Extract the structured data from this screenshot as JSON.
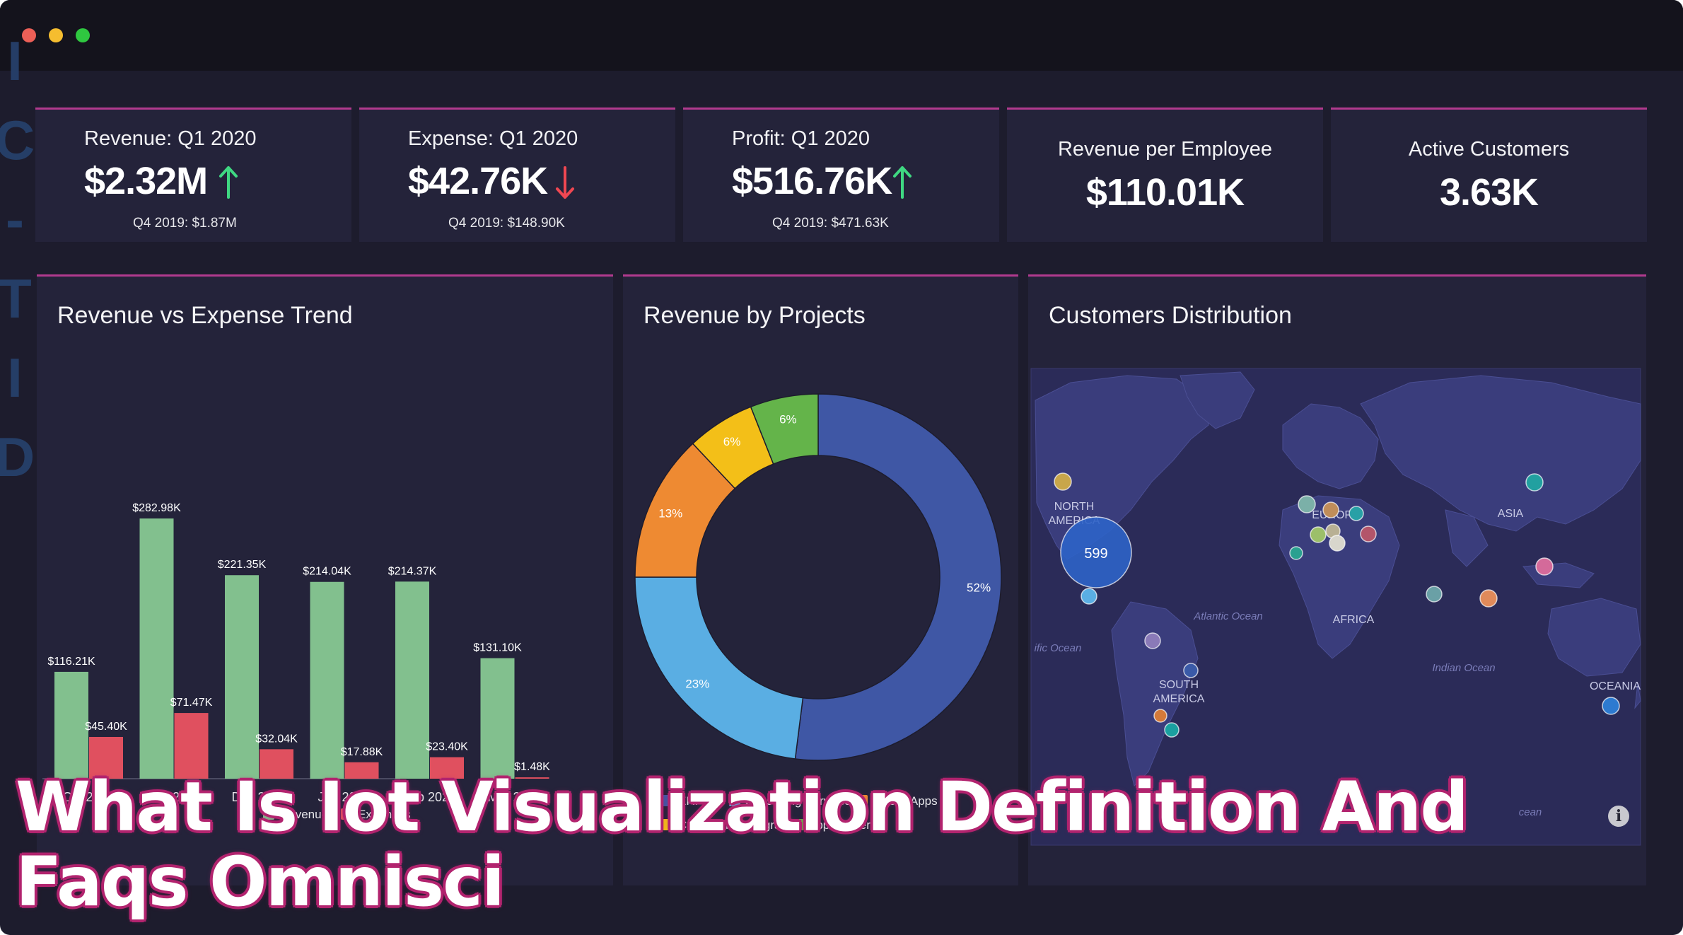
{
  "window": {
    "traffic_lights": [
      "#ec5f57",
      "#f5bd2f",
      "#2fc840"
    ],
    "side_letters": "IC-TID"
  },
  "kpis": [
    {
      "title": "Revenue: Q1 2020",
      "value": "$2.32M",
      "trend": "up",
      "previous": "Q4 2019: $1.87M"
    },
    {
      "title": "Expense: Q1 2020",
      "value": "$42.76K",
      "trend": "down",
      "previous": "Q4 2019: $148.90K"
    },
    {
      "title": "Profit: Q1 2020",
      "value": "$516.76K",
      "trend": "up",
      "previous": "Q4 2019: $471.63K"
    },
    {
      "title": "Revenue per Employee",
      "value": "$110.01K"
    },
    {
      "title": "Active Customers",
      "value": "3.63K"
    }
  ],
  "colors": {
    "up": "#3fd882",
    "down": "#f04752",
    "accent": "#b13a8e",
    "revenue": "#82c08e",
    "expense": "#e0505f"
  },
  "panels": {
    "trend_title": "Revenue vs Expense Trend",
    "projects_title": "Revenue by Projects",
    "customers_title": "Customers Distribution"
  },
  "trend_legend": [
    "Revenue",
    "Expenses"
  ],
  "chart_data": [
    {
      "type": "bar",
      "title": "Revenue vs Expense Trend",
      "categories": [
        "Oct 2019",
        "Nov 2019",
        "Dec 2019",
        "Jan 2020",
        "Feb 2020",
        "Mar 2020"
      ],
      "series": [
        {
          "name": "Revenue",
          "values": [
            116.21,
            282.98,
            221.35,
            214.04,
            214.37,
            131.1
          ],
          "labels": [
            "$116.21K",
            "$282.98K",
            "$221.35K",
            "$214.04K",
            "$214.37K",
            "$131.10K"
          ],
          "color": "#82c08e"
        },
        {
          "name": "Expenses",
          "values": [
            45.4,
            71.47,
            32.04,
            17.88,
            23.4,
            1.48
          ],
          "labels": [
            "$45.40K",
            "$71.47K",
            "$32.04K",
            "$17.88K",
            "$23.40K",
            "$1.48K"
          ],
          "color": "#e0505f"
        }
      ],
      "ylim": [
        0,
        300
      ],
      "legend": "bottom-left"
    },
    {
      "type": "pie",
      "title": "Revenue by Projects",
      "donut": true,
      "slices": [
        {
          "label": "ERP",
          "value": 52,
          "text": "52%",
          "color": "#3f57a5"
        },
        {
          "label": "Consulting Services",
          "value": 23,
          "text": "23%",
          "color": "#5aaee3"
        },
        {
          "label": "Mobile Apps",
          "value": 13,
          "text": "13%",
          "color": "#ee8a32"
        },
        {
          "label": "Certification Programs",
          "value": 6,
          "text": "6%",
          "color": "#f3bf18"
        },
        {
          "label": "App Builder",
          "value": 6,
          "text": "6%",
          "color": "#64b44a"
        }
      ],
      "legend": "bottom"
    }
  ],
  "map": {
    "labels": [
      {
        "text": "NORTH AMERICA",
        "lines": [
          "NORTH",
          "AMERICA"
        ]
      },
      {
        "text": "EUROPE",
        "lines": [
          "EUROPE"
        ]
      },
      {
        "text": "ASIA",
        "lines": [
          "ASIA"
        ]
      },
      {
        "text": "AFRICA",
        "lines": [
          "AFRICA"
        ]
      },
      {
        "text": "SOUTH AMERICA",
        "lines": [
          "SOUTH",
          "AMERICA"
        ]
      },
      {
        "text": "OCEANIA",
        "lines": [
          "OCEANIA"
        ]
      }
    ],
    "ocean_labels": [
      "Atlantic Ocean",
      "ific Ocean",
      "Indian Ocean",
      "cean"
    ],
    "bubble_value": "599"
  },
  "overlay_caption": "What Is Iot Visualization Definition And Faqs Omnisci"
}
